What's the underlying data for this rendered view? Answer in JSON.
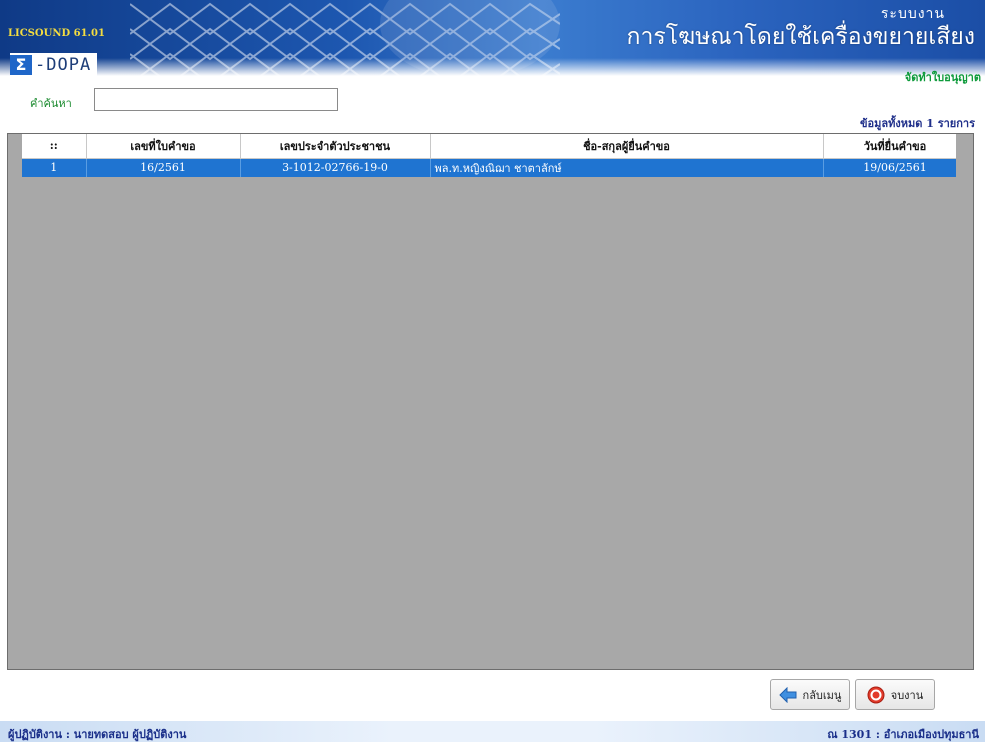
{
  "header": {
    "app_version": "LICSOUND 61.01",
    "logo_text": "-DOPA",
    "system_label": "ระบบงาน",
    "system_title": "การโฆษณาโดยใช้เครื่องขยายเสียง",
    "page_subtitle": "จัดทำใบอนุญาต"
  },
  "search": {
    "label": "คำค้นหา",
    "value": ""
  },
  "record_count": "ข้อมูลทั้งหมด 1 รายการ",
  "grid": {
    "columns": [
      "::",
      "เลขที่ใบคำขอ",
      "เลขประจำตัวประชาชน",
      "ชื่อ-สกุลผู้ยื่นคำขอ",
      "วันที่ยื่นคำขอ"
    ],
    "rows": [
      [
        "1",
        "16/2561",
        "3-1012-02766-19-0",
        "พล.ท.หญิงณิฌา ชาตาลักษ์",
        "19/06/2561"
      ]
    ],
    "selected_row_color": "#1f74d1",
    "background_color": "#a8a8a8"
  },
  "buttons": {
    "back": {
      "label": "กลับเมนู",
      "icon": "left-arrow-icon"
    },
    "exit": {
      "label": "จบงาน",
      "icon": "power-icon"
    }
  },
  "status": {
    "user": "ผู้ปฏิบัติงาน : นายทดสอบ ผู้ปฏิบัติงาน",
    "office": "ณ 1301 : อำเภอเมืองปทุมธานี"
  },
  "colors": {
    "header_blue": "#1d57b0",
    "subtitle_green": "#0d9a3a",
    "status_text": "#1a2f8a"
  }
}
